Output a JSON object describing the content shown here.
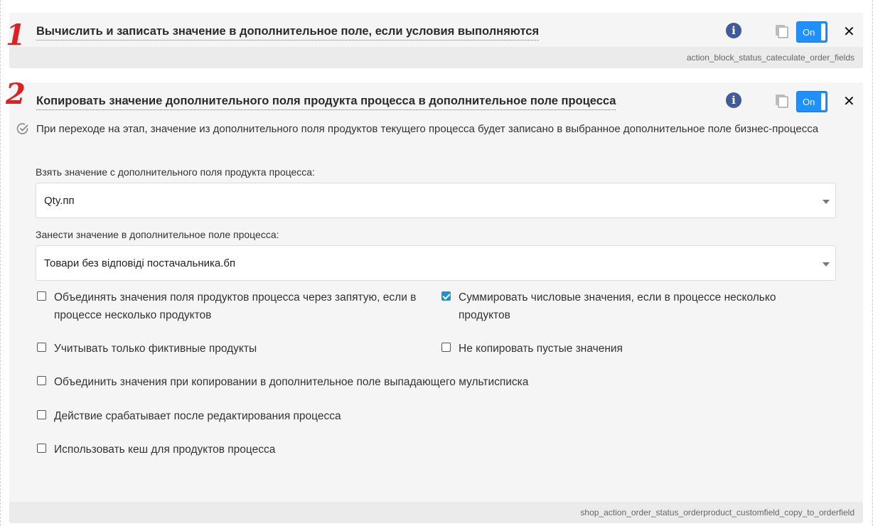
{
  "annotations": {
    "step1": "1",
    "step2": "2"
  },
  "block1": {
    "title": "Вычислить и записать значение в дополнительное поле, если условия выполняются",
    "toggle_label": "On",
    "footer_code": "action_block_status_cateculate_order_fields"
  },
  "block2": {
    "title": "Копировать значение дополнительного поля продукта процесса в дополнительное поле процесса",
    "toggle_label": "On",
    "description": "При переходе на этап, значение из дополнительного поля продуктов текущего процесса будет записано в выбранное дополнительное поле бизнес-процесса",
    "source_label": "Взять значение с дополнительного поля продукта процесса:",
    "source_value": "Qty.пп",
    "target_label": "Занести значение в дополнительное поле процесса:",
    "target_value": "Товари без відповіді постачальника.бп",
    "options": [
      {
        "label": "Объединять значения поля продуктов процесса через запятую, если в процессе несколько продуктов",
        "checked": false
      },
      {
        "label": "Суммировать числовые значения, если в процессе несколько продуктов",
        "checked": true
      },
      {
        "label": "Учитывать только фиктивные продукты",
        "checked": false
      },
      {
        "label": "Не копировать пустые значения",
        "checked": false
      },
      {
        "label": "Объединить значения при копировании в дополнительное поле выпадающего мультисписка",
        "checked": false
      },
      {
        "label": "Действие срабатывает после редактирования процесса",
        "checked": false
      },
      {
        "label": "Использовать кеш для продуктов процесса",
        "checked": false
      }
    ],
    "footer_code": "shop_action_order_status_orderproduct_customfield_copy_to_orderfield"
  },
  "icons": {
    "info": "info-icon",
    "copy": "copy-icon",
    "close": "close-icon",
    "check_circle": "check-circle-icon"
  },
  "colors": {
    "accent": "#1e90ff",
    "info": "#3f5b9a",
    "annotation": "#e02020",
    "checkbox": "#2a8fc0"
  }
}
